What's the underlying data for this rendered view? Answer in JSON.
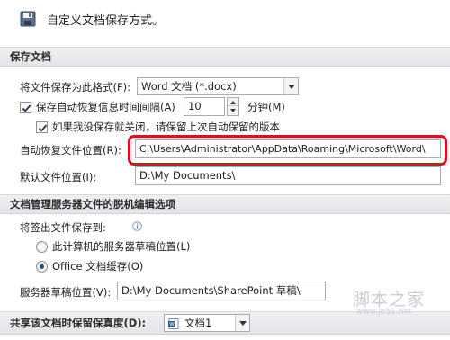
{
  "header": {
    "icon": "save-disk-icon",
    "title": "自定义文档保存方式。"
  },
  "save_section": {
    "title": "保存文档",
    "format": {
      "label": "将文件保存为此格式(F):",
      "value": "Word 文档 (*.docx)"
    },
    "autorecover": {
      "checked": true,
      "label": "保存自动恢复信息时间间隔(A)",
      "minutes": "10",
      "unit": "分钟(M)"
    },
    "keep_last": {
      "checked": true,
      "label": "如果我没保存就关闭，请保留上次自动保留的版本"
    },
    "autorecover_location": {
      "label": "自动恢复文件位置(R):",
      "value": "C:\\Users\\Administrator\\AppData\\Roaming\\Microsoft\\Word\\"
    },
    "default_location": {
      "label": "默认文件位置(I):",
      "value": "D:\\My Documents\\"
    }
  },
  "offline_section": {
    "title": "文档管理服务器文件的脱机编辑选项",
    "checkout_label": "将签出文件保存到:",
    "info_icon": "info-icon",
    "options": [
      {
        "label": "此计算机的服务器草稿位置(L)",
        "selected": false
      },
      {
        "label": "Office 文档缓存(O)",
        "selected": true
      }
    ],
    "drafts_location": {
      "label": "服务器草稿位置(V):",
      "value": "D:\\My Documents\\SharePoint 草稿\\"
    }
  },
  "share_section": {
    "title": "共享该文档时保留保真度(D):",
    "doc_icon": "word-document-icon",
    "document": "文档1"
  },
  "watermark": {
    "big": "脚本之家",
    "small": "www.jb51.net"
  },
  "colors": {
    "highlight": "#d9141b",
    "section_bg": "#e8eaed",
    "radio_dot": "#1d4e8c"
  }
}
